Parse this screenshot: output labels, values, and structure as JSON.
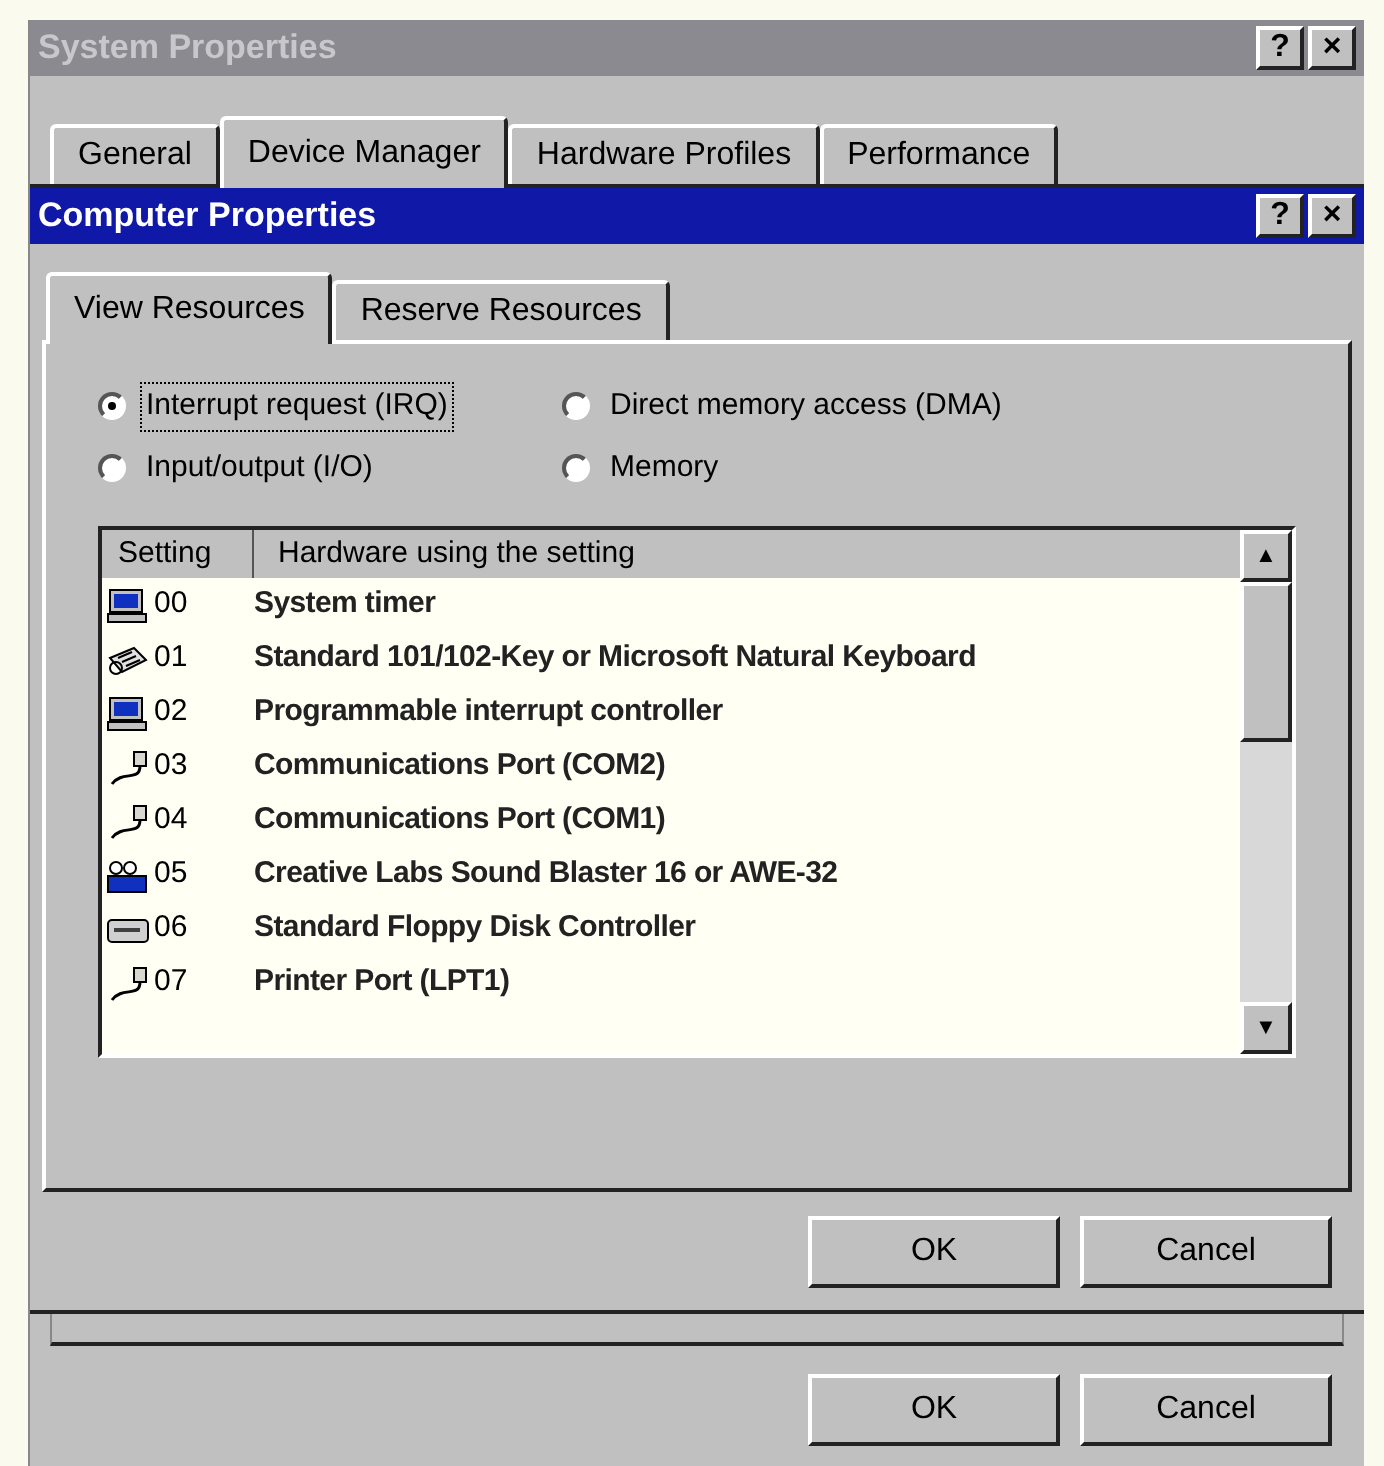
{
  "outer_window": {
    "title": "System Properties",
    "title_buttons": [
      "?",
      "×"
    ],
    "tabs": [
      {
        "label": "General",
        "selected": false
      },
      {
        "label": "Device Manager",
        "selected": true
      },
      {
        "label": "Hardware Profiles",
        "selected": false
      },
      {
        "label": "Performance",
        "selected": false
      }
    ],
    "buttons": [
      "OK",
      "Cancel"
    ]
  },
  "dialog": {
    "title": "Computer Properties",
    "title_buttons": [
      "?",
      "×"
    ],
    "tabs": [
      {
        "label": "View Resources",
        "selected": true
      },
      {
        "label": "Reserve Resources",
        "selected": false
      }
    ],
    "radios": [
      {
        "label": "Interrupt request (IRQ)",
        "selected": true
      },
      {
        "label": "Direct memory access (DMA)",
        "selected": false
      },
      {
        "label": "Input/output (I/O)",
        "selected": false
      },
      {
        "label": "Memory",
        "selected": false
      }
    ],
    "table": {
      "columns": [
        "Setting",
        "Hardware using the setting"
      ],
      "rows": [
        {
          "kind": "computer",
          "setting": "00",
          "hardware": "System timer"
        },
        {
          "kind": "keyboard",
          "setting": "01",
          "hardware": "Standard 101/102-Key or Microsoft Natural Keyboard"
        },
        {
          "kind": "computer",
          "setting": "02",
          "hardware": "Programmable interrupt controller"
        },
        {
          "kind": "port",
          "setting": "03",
          "hardware": "Communications Port (COM2)"
        },
        {
          "kind": "port",
          "setting": "04",
          "hardware": "Communications Port (COM1)"
        },
        {
          "kind": "sound",
          "setting": "05",
          "hardware": "Creative Labs Sound Blaster 16 or AWE-32"
        },
        {
          "kind": "floppy",
          "setting": "06",
          "hardware": "Standard Floppy Disk Controller"
        },
        {
          "kind": "port",
          "setting": "07",
          "hardware": "Printer Port (LPT1)"
        }
      ],
      "scroll_arrows": [
        "▲",
        "▼"
      ]
    },
    "buttons": [
      "OK",
      "Cancel"
    ]
  }
}
